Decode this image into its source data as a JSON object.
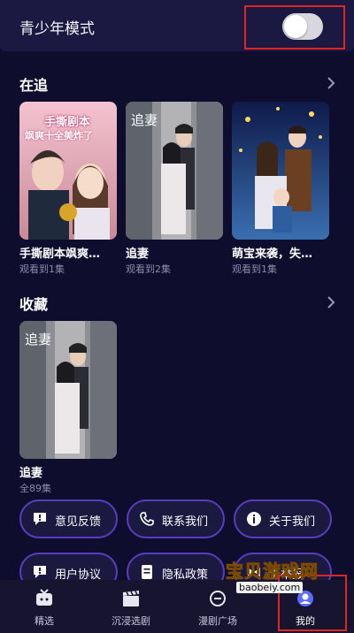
{
  "teen_mode": {
    "label": "青少年模式",
    "enabled": false
  },
  "following": {
    "title": "在追",
    "items": [
      {
        "title": "手撕剧本飒爽…",
        "progress": "观看到1集",
        "poster_text": [
          "手撕剧本",
          "飒爽十全美炸了"
        ]
      },
      {
        "title": "追妻",
        "progress": "观看到2集",
        "poster_text": [
          "追妻"
        ]
      },
      {
        "title": "萌宝来袭，失…",
        "progress": "观看到1集",
        "poster_text": []
      }
    ]
  },
  "favorites": {
    "title": "收藏",
    "items": [
      {
        "title": "追妻",
        "progress": "全89集",
        "poster_text": [
          "追妻"
        ]
      }
    ]
  },
  "actions": [
    {
      "label": "意见反馈",
      "icon": "feedback-icon"
    },
    {
      "label": "联系我们",
      "icon": "phone-icon"
    },
    {
      "label": "关于我们",
      "icon": "info-icon"
    },
    {
      "label": "用户协议",
      "icon": "agreement-icon"
    },
    {
      "label": "隐私政策",
      "icon": "document-icon"
    },
    {
      "label": "诉举报",
      "icon": "report-icon"
    }
  ],
  "tabs": [
    {
      "label": "精选",
      "icon": "tv-icon"
    },
    {
      "label": "沉浸选剧",
      "icon": "clapper-icon"
    },
    {
      "label": "漫剧广场",
      "icon": "square-icon"
    },
    {
      "label": "我的",
      "icon": "profile-icon",
      "active": true
    }
  ],
  "watermark": {
    "main": "宝贝游戏网",
    "sub": "baobeiy.com"
  },
  "colors": {
    "background": "#0f0d2e",
    "pill_border": "#5a3cc0",
    "highlight": "#e02525"
  }
}
